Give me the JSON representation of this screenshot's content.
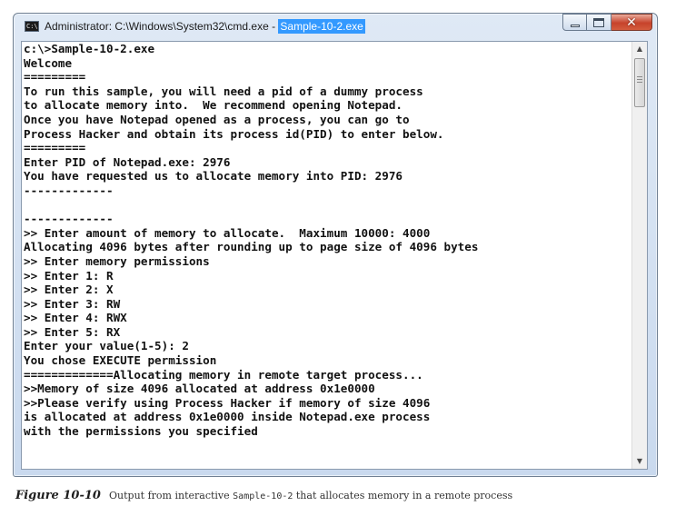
{
  "window": {
    "title_prefix": "Administrator: C:\\Windows\\System32\\cmd.exe - ",
    "title_selected": "Sample-10-2.exe",
    "icon_label": "C:\\",
    "buttons": {
      "close_glyph": "✕"
    }
  },
  "console": {
    "lines": [
      "c:\\>Sample-10-2.exe",
      "Welcome",
      "=========",
      "To run this sample, you will need a pid of a dummy process",
      "to allocate memory into.  We recommend opening Notepad.",
      "Once you have Notepad opened as a process, you can go to",
      "Process Hacker and obtain its process id(PID) to enter below.",
      "=========",
      "Enter PID of Notepad.exe: 2976",
      "You have requested us to allocate memory into PID: 2976",
      "-------------",
      "",
      "-------------",
      ">> Enter amount of memory to allocate.  Maximum 10000: 4000",
      "Allocating 4096 bytes after rounding up to page size of 4096 bytes",
      ">> Enter memory permissions",
      ">> Enter 1: R",
      ">> Enter 2: X",
      ">> Enter 3: RW",
      ">> Enter 4: RWX",
      ">> Enter 5: RX",
      "Enter your value(1-5): 2",
      "You chose EXECUTE permission",
      "=============Allocating memory in remote target process...",
      ">>Memory of size 4096 allocated at address 0x1e0000",
      ">>Please verify using Process Hacker if memory of size 4096",
      "is allocated at address 0x1e0000 inside Notepad.exe process",
      "with the permissions you specified"
    ]
  },
  "scrollbar": {
    "up_glyph": "▲",
    "down_glyph": "▼"
  },
  "caption": {
    "label": "Figure 10-10",
    "text_before": "Output from interactive ",
    "code": "Sample-10-2",
    "text_after": " that allocates memory in a remote process"
  },
  "colors": {
    "title_selection": "#3399ff",
    "close_button": "#c7432b",
    "console_text": "#111111",
    "console_background": "#ffffff"
  }
}
